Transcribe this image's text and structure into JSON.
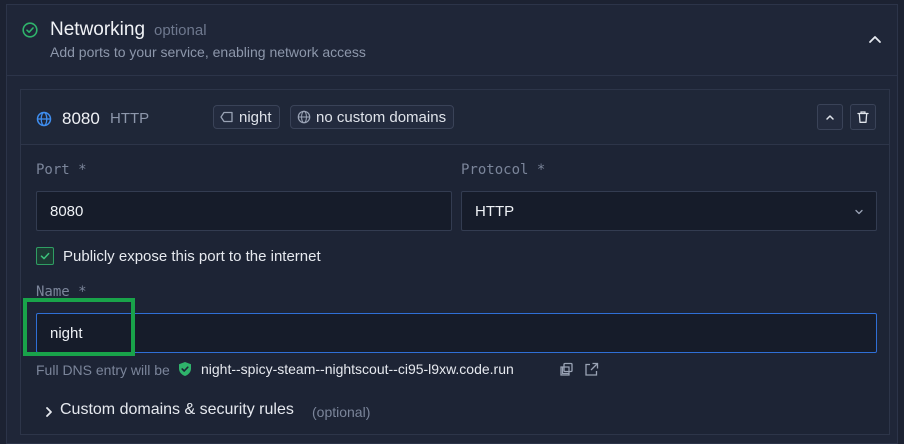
{
  "section": {
    "title": "Networking",
    "optional_label": "optional",
    "subtitle": "Add ports to your service, enabling network access"
  },
  "port_card": {
    "port": "8080",
    "protocol": "HTTP",
    "chips": [
      {
        "label": "night",
        "icon": "tag-icon"
      },
      {
        "label": "no custom domains",
        "icon": "globe-icon"
      }
    ]
  },
  "form": {
    "port_label": "Port *",
    "port_value": "8080",
    "protocol_label": "Protocol *",
    "protocol_value": "HTTP",
    "expose_label": "Publicly expose this port to the internet",
    "expose_checked": true,
    "name_label": "Name *",
    "name_value": "night"
  },
  "dns": {
    "prefix": "Full DNS entry will be",
    "host": "night--spicy-steam--nightscout--ci95-l9xw.code.run"
  },
  "custom_domains": {
    "label": "Custom domains & security rules",
    "optional": "(optional)"
  },
  "colors": {
    "accent_green": "#2f9e63",
    "focus_blue": "#2f6fd6",
    "highlight": "#19a34a"
  }
}
